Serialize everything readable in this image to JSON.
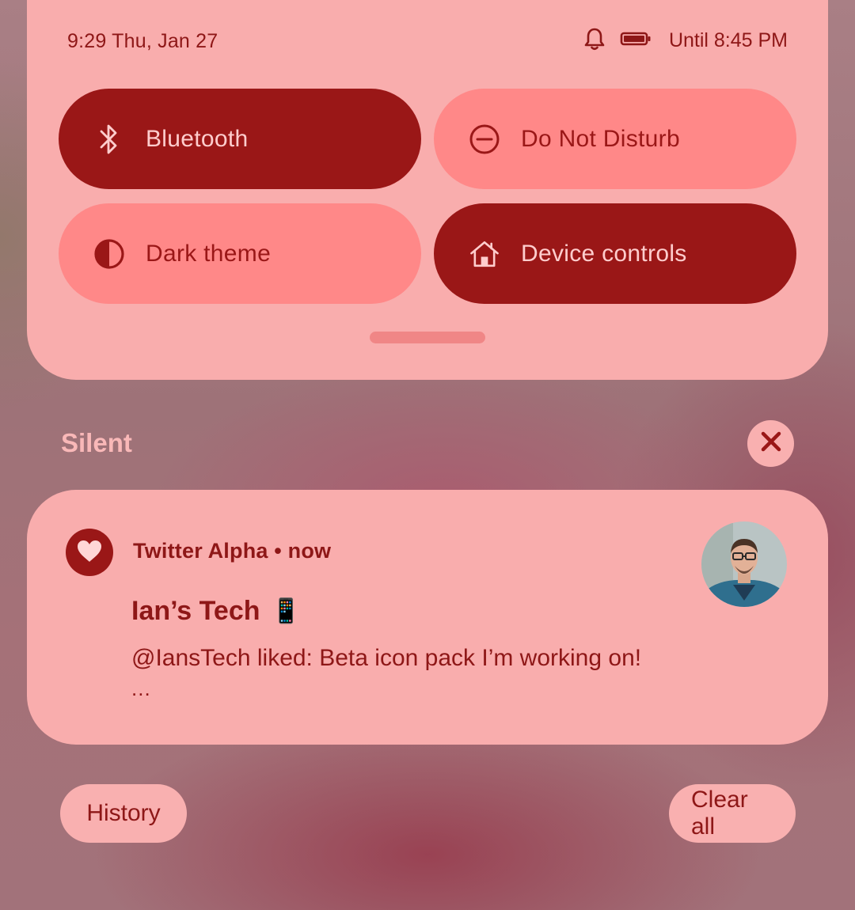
{
  "status_bar": {
    "datetime": "9:29 Thu, Jan 27",
    "battery_text": "Until 8:45 PM",
    "icons": [
      "bell-icon",
      "battery-icon"
    ]
  },
  "quick_settings": {
    "tiles": [
      {
        "label": "Bluetooth",
        "state": "on",
        "icon": "bluetooth-icon"
      },
      {
        "label": "Do Not Disturb",
        "state": "off",
        "icon": "do-not-disturb-icon"
      },
      {
        "label": "Dark theme",
        "state": "off",
        "icon": "dark-theme-icon"
      },
      {
        "label": "Device controls",
        "state": "on",
        "icon": "home-icon"
      }
    ]
  },
  "notifications": {
    "section_title": "Silent",
    "items": [
      {
        "app": "Twitter Alpha",
        "separator": " • ",
        "time": "now",
        "title": "Ian’s Tech",
        "title_emoji": "📱",
        "text": "@IansTech liked: Beta icon pack I’m working on!",
        "more": "..."
      }
    ]
  },
  "footer": {
    "history_label": "History",
    "clear_all_label": "Clear all"
  },
  "colors": {
    "panel": "#f9adad",
    "tile_on": "#9a1717",
    "tile_off": "#ff8888",
    "accent_text": "#8e1717"
  }
}
